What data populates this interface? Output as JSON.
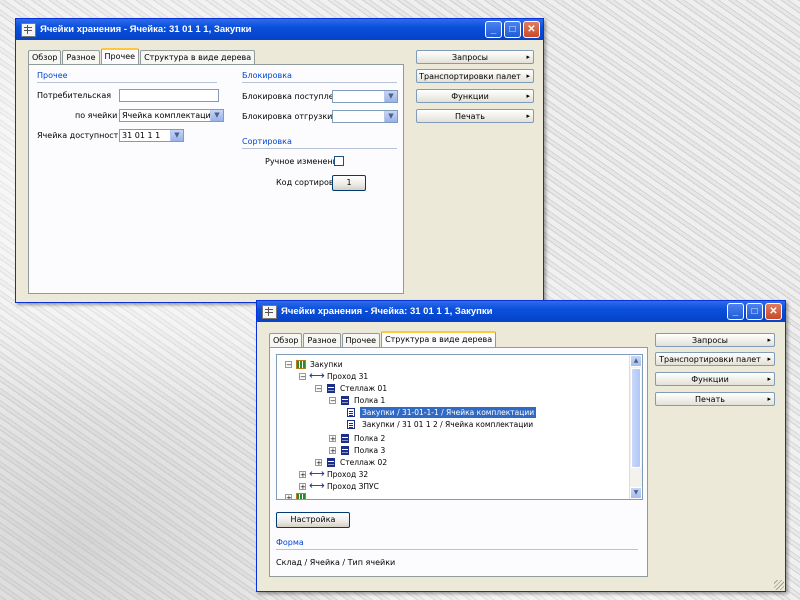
{
  "window1": {
    "title": "Ячейки хранения - Ячейка: 31 01 1 1, Закупки",
    "title_buttons": {
      "minimize": "_",
      "maximize": "□",
      "close": "✕"
    },
    "tabs": [
      "Обзор",
      "Разное",
      "Прочее",
      "Структура в виде дерева"
    ],
    "active_tab": "Прочее",
    "side_buttons": [
      "Запросы",
      "Транспортировки палет",
      "Функции",
      "Печать"
    ],
    "groups": {
      "other": "Прочее",
      "lock": "Блокировка",
      "sort": "Сортировка"
    },
    "fields": {
      "access_point_label": "Потребительская",
      "access_point_value": "",
      "cell_type_label": "по ячейки",
      "cell_type_value": "Ячейка комплектации",
      "access_cell_label": "Ячейка доступности",
      "access_cell_value": "31 01 1 1",
      "lock_stock_label": "Блокировка поступления",
      "lock_stock_value": "",
      "lock_out_label": "Блокировка отгрузки",
      "lock_out_value": "",
      "manual_change_label": "Ручное изменение",
      "sort_code_label": "Код сортировки",
      "sort_code_value": "1"
    }
  },
  "window2": {
    "title": "Ячейки хранения - Ячейка: 31 01 1 1, Закупки",
    "title_buttons": {
      "minimize": "_",
      "maximize": "□",
      "close": "✕"
    },
    "tabs": [
      "Обзор",
      "Разное",
      "Прочее",
      "Структура в виде дерева"
    ],
    "active_tab": "Структура в виде дерева",
    "side_buttons": [
      "Запросы",
      "Транспортировки палет",
      "Функции",
      "Печать"
    ],
    "tree": [
      {
        "label": "Закупки",
        "expander": "−",
        "icon": "grid-icon"
      },
      {
        "label": "Проход 31",
        "expander": "−",
        "icon": "aisle-arrow-icon"
      },
      {
        "label": "Стеллаж 01",
        "expander": "−",
        "icon": "rack-icon"
      },
      {
        "label": "Полка 1",
        "expander": "−",
        "icon": "shelf-icon"
      },
      {
        "label": "Закупки / 31-01-1-1 / Ячейка комплектации",
        "expander": "",
        "icon": "cell-icon",
        "selected": true
      },
      {
        "label": "Закупки / 31 01 1 2 / Ячейка комплектации",
        "expander": "",
        "icon": "cell-icon"
      },
      {
        "label": "Полка 2",
        "expander": "+",
        "icon": "shelf-icon"
      },
      {
        "label": "Полка 3",
        "expander": "+",
        "icon": "shelf-icon"
      },
      {
        "label": "Стеллаж 02",
        "expander": "+",
        "icon": "rack-icon"
      },
      {
        "label": "Проход 32",
        "expander": "+",
        "icon": "aisle-arrow-icon"
      },
      {
        "label": "Проход ЗПУС",
        "expander": "+",
        "icon": "aisle-arrow-icon"
      },
      {
        "label": "...",
        "expander": "+",
        "icon": "grid-icon"
      }
    ],
    "settings_button": "Настройка",
    "form_group": "Форма",
    "form_value": "Склад / Ячейка / Тип ячейки"
  }
}
